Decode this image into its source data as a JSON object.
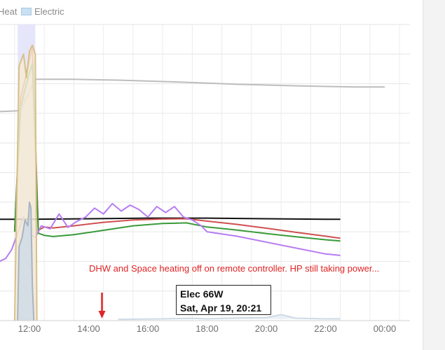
{
  "legend": {
    "heat_label": "Heat",
    "electric_label": "Electric",
    "electric_color": "#c9e0f3"
  },
  "annotation": "DHW and Space heating off on remote controller. HP still taking power...",
  "tooltip": {
    "line1": "Elec 66W",
    "line2": "Sat, Apr 19, 20:21"
  },
  "arrow_color": "#e02424",
  "chart_data": {
    "type": "line",
    "x_unit": "hour",
    "xlim": [
      10.8,
      25.0
    ],
    "x_ticks": [
      "12:00",
      "14:00",
      "16:00",
      "18:00",
      "20:00",
      "22:00",
      "00:00"
    ],
    "y_scale_hidden": true,
    "ylim": [
      0,
      100
    ],
    "grid": true,
    "highlight_band": [
      11.6,
      12.2
    ],
    "series": [
      {
        "color": "#bdbdbd",
        "x": [
          10.8,
          11.5,
          11.7,
          12.2,
          12.3,
          13.5,
          15.0,
          17.0,
          19.0,
          21.0,
          23.0,
          24.0
        ],
        "y": [
          70.5,
          70.8,
          71.0,
          81.5,
          81.5,
          81.5,
          81.2,
          80.6,
          79.8,
          79.3,
          78.9,
          78.9
        ]
      },
      {
        "color": "#111111",
        "x": [
          10.8,
          12.0,
          14.0,
          16.0,
          18.0,
          20.0,
          22.0,
          22.5
        ],
        "y": [
          34.2,
          34.2,
          34.4,
          34.6,
          34.6,
          34.4,
          34.2,
          34.2
        ]
      },
      {
        "color": "#d05050",
        "x": [
          11.5,
          11.7,
          11.9,
          12.1,
          12.3,
          12.5,
          12.8,
          13.5,
          14.5,
          15.5,
          16.5,
          17.3,
          18.0,
          19.0,
          20.0,
          21.0,
          22.0,
          22.5
        ],
        "y": [
          30.0,
          75.0,
          83.5,
          92.5,
          30.5,
          31.6,
          31.3,
          32.0,
          33.2,
          34.0,
          34.3,
          34.4,
          33.6,
          32.5,
          31.2,
          29.8,
          28.5,
          27.8
        ]
      },
      {
        "color": "#3a9a3a",
        "x": [
          11.5,
          11.7,
          11.9,
          12.1,
          12.3,
          12.5,
          12.8,
          13.5,
          14.5,
          15.5,
          16.5,
          17.3,
          18.0,
          19.0,
          20.0,
          21.0,
          22.0,
          22.5
        ],
        "y": [
          30.0,
          72.0,
          80.0,
          87.0,
          29.5,
          28.8,
          28.4,
          29.0,
          30.5,
          32.0,
          32.8,
          33.0,
          31.6,
          30.6,
          29.4,
          28.3,
          27.3,
          26.9
        ]
      },
      {
        "color": "#b67df2",
        "x": [
          10.8,
          11.0,
          11.2,
          11.4,
          11.6,
          11.8,
          12.0,
          12.2,
          12.4,
          12.7,
          13.0,
          13.3,
          13.6,
          13.9,
          14.2,
          14.5,
          14.8,
          15.1,
          15.4,
          15.7,
          16.0,
          16.3,
          16.6,
          16.9,
          17.2,
          17.5,
          17.8,
          18.0,
          19.0,
          20.0,
          21.0,
          22.0,
          22.5
        ],
        "y": [
          19.0,
          20.0,
          21.0,
          24.0,
          29.5,
          35.0,
          29.5,
          28.0,
          32.0,
          31.0,
          36.0,
          31.5,
          33.5,
          35.0,
          38.0,
          36.0,
          39.5,
          37.0,
          39.0,
          37.5,
          35.0,
          38.5,
          36.5,
          38.5,
          35.0,
          34.0,
          32.0,
          30.0,
          28.5,
          26.5,
          24.5,
          22.5,
          22.0
        ]
      },
      {
        "color": "#d8c08a",
        "fill": "#f5ead3",
        "x": [
          11.5,
          11.55,
          11.65,
          11.8,
          11.9,
          12.0,
          12.1,
          12.2,
          12.25
        ],
        "y": [
          0,
          30.0,
          86.0,
          90.0,
          82.0,
          91.0,
          93.0,
          90.0,
          0
        ]
      },
      {
        "color": "#a8b4c0",
        "fill": "#cfdae6",
        "x": [
          11.6,
          11.65,
          11.75,
          11.85,
          11.95,
          12.0,
          12.05,
          12.1,
          12.15
        ],
        "y": [
          0,
          25.0,
          28.0,
          34.0,
          32.0,
          40.0,
          38.0,
          12.0,
          0
        ]
      },
      {
        "color": "#cfdae6",
        "fill": "#e6eef6",
        "x": [
          15.0,
          16.5,
          17.5,
          18.0,
          19.0,
          20.0,
          20.5,
          21.0,
          22.0,
          22.5
        ],
        "y": [
          0.4,
          0.6,
          0.8,
          0.6,
          0.9,
          1.0,
          2.0,
          0.8,
          0.6,
          0.6
        ]
      }
    ]
  }
}
